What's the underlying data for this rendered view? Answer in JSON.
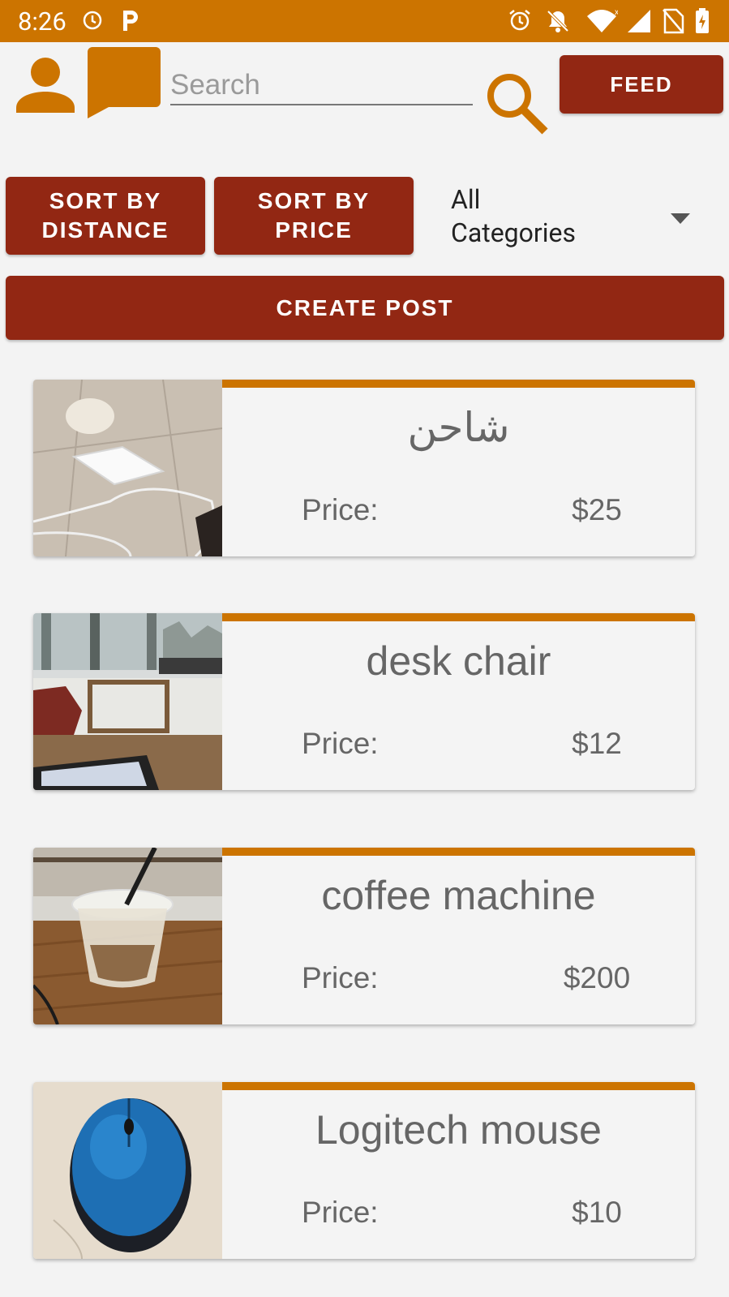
{
  "status_bar": {
    "time": "8:26",
    "icons": [
      "alarm-icon",
      "p-app-icon",
      "alarm-icon",
      "notifications-off-icon",
      "wifi-icon",
      "signal-icon",
      "no-sim-icon",
      "battery-charging-icon"
    ]
  },
  "header": {
    "search_placeholder": "Search",
    "feed_label": "FEED",
    "icons": [
      "person-icon",
      "chat-icon",
      "search-icon"
    ]
  },
  "controls": {
    "sort_distance_line1": "SORT BY",
    "sort_distance_line2": "DISTANCE",
    "sort_price_line1": "SORT BY",
    "sort_price_line2": "PRICE",
    "category_line1": "All",
    "category_line2": "Categories",
    "create_post_label": "CREATE POST"
  },
  "listings": [
    {
      "title": "شاحن",
      "price_label": "Price:",
      "price": "$25",
      "image": "white charger on floor"
    },
    {
      "title": "desk chair",
      "price_label": "Price:",
      "price": "$12",
      "image": "wooden chair at table"
    },
    {
      "title": "coffee machine",
      "price_label": "Price:",
      "price": "$200",
      "image": "iced coffee cup on table"
    },
    {
      "title": "Logitech mouse",
      "price_label": "Price:",
      "price": "$10",
      "image": "blue wireless mouse"
    }
  ],
  "colors": {
    "accent": "#cc7400",
    "button": "#922713",
    "background": "#f3f3f3"
  }
}
